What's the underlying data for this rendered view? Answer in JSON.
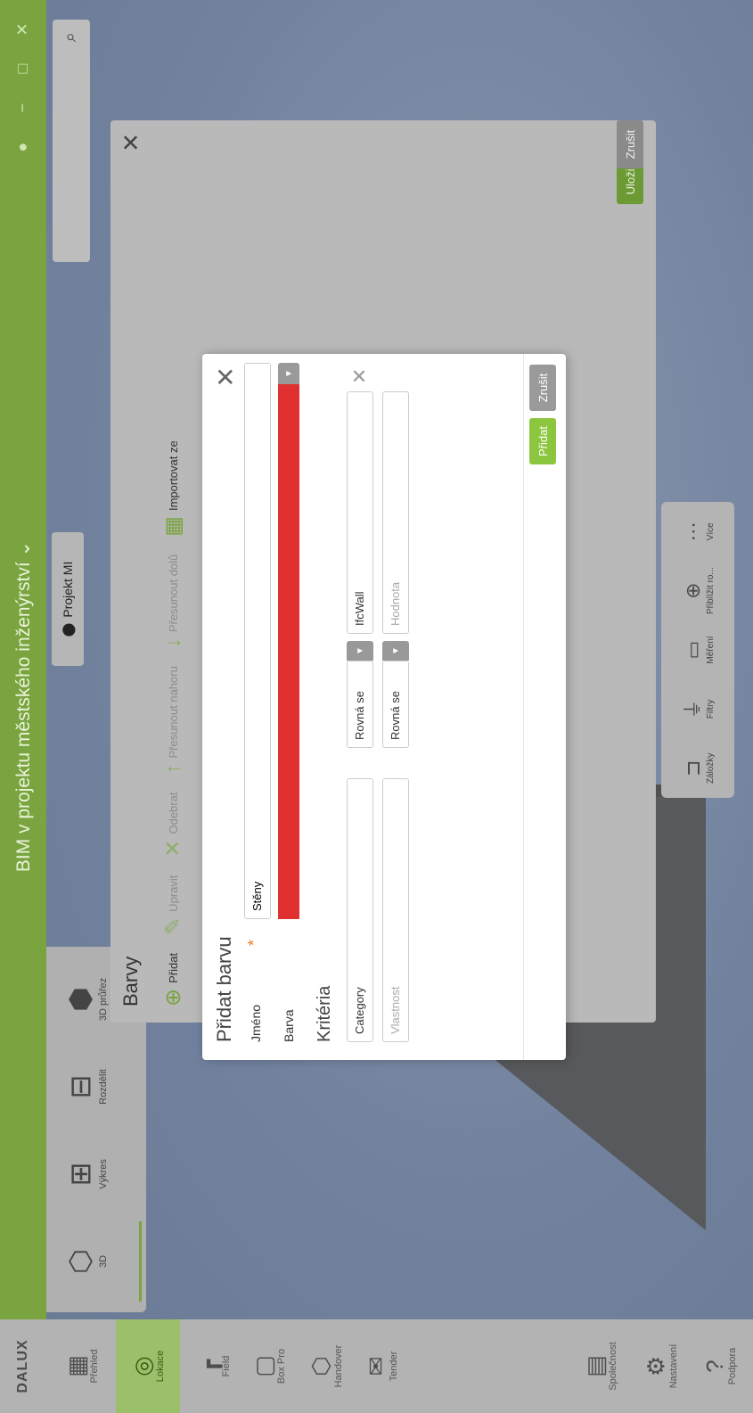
{
  "topbar": {
    "title": "BIM v projektu městského inženýrství  ⌄"
  },
  "sidebar": {
    "logo": "DALUX",
    "items": [
      {
        "label": "Přehled",
        "icon": "grid-icon"
      },
      {
        "label": "Lokace",
        "icon": "location-icon"
      },
      {
        "label": "Field",
        "icon": "crane-icon"
      },
      {
        "label": "Box Pro",
        "icon": "box-icon"
      },
      {
        "label": "Handover",
        "icon": "handover-icon"
      },
      {
        "label": "Tender",
        "icon": "tender-icon"
      },
      {
        "label": "Společnost",
        "icon": "building-icon"
      },
      {
        "label": "Nastavení",
        "icon": "gear-icon"
      },
      {
        "label": "Podpora",
        "icon": "help-icon"
      }
    ]
  },
  "modes": [
    {
      "label": "3D"
    },
    {
      "label": "Výkres"
    },
    {
      "label": "Rozdělit"
    },
    {
      "label": "3D průřez"
    }
  ],
  "project": {
    "label": "Projekt MI"
  },
  "bottombar": [
    {
      "label": "Záložky"
    },
    {
      "label": "Filtry"
    },
    {
      "label": "Měření"
    },
    {
      "label": "Přiblížit ro..."
    },
    {
      "label": "Více"
    }
  ],
  "barvy": {
    "title": "Barvy",
    "toolbar": {
      "add": "Přidat",
      "edit": "Upravit",
      "remove": "Odebrat",
      "move_up": "Přesunout nahoru",
      "move_down": "Přesunout dolů",
      "import": "Importovat ze"
    },
    "save": "Uložit",
    "cancel": "Zrušit"
  },
  "dialog": {
    "title": "Přidat barvu",
    "name_label": "Jméno",
    "name_value": "Stěny",
    "color_label": "Barva",
    "color_value": "#e03030",
    "criteria_title": "Kritéria",
    "row1": {
      "property": "Category",
      "operator": "Rovná se",
      "value": "IfcWall"
    },
    "row2": {
      "property_placeholder": "Vlastnost",
      "operator": "Rovná se",
      "value_placeholder": "Hodnota"
    },
    "add": "Přidat",
    "cancel": "Zrušit"
  }
}
